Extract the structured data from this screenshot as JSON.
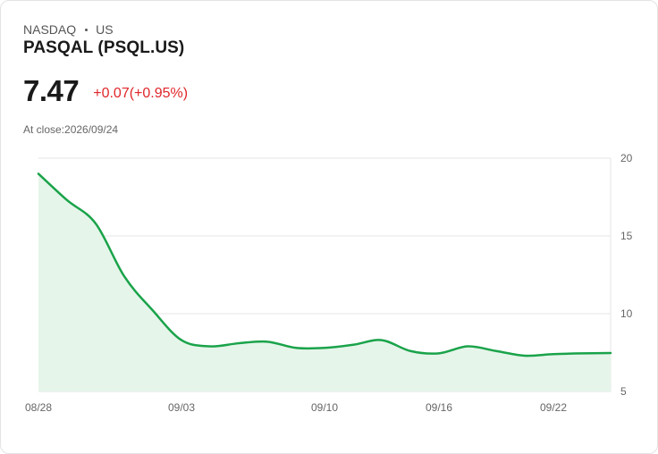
{
  "quote": {
    "exchange": "NASDAQ",
    "market": "US",
    "name": "PASQAL (PSQL.US)",
    "price": "7.47",
    "change": "+0.07(+0.95%)",
    "close_label": "At close:",
    "close_date": "2026/09/24"
  },
  "colors": {
    "up": "#e0262a",
    "line": "#1aa34a",
    "fill": "#e6f5ea",
    "grid": "#e6e6e6"
  },
  "chart_data": {
    "type": "area",
    "title": "",
    "xlabel": "",
    "ylabel": "",
    "ylim": [
      5,
      20
    ],
    "y_ticks": [
      "20",
      "15",
      "10",
      "5"
    ],
    "x_tick_labels": [
      "08/28",
      "09/03",
      "09/10",
      "09/16",
      "09/22"
    ],
    "grid": true,
    "y_axis_side": "right",
    "series": [
      {
        "x": [
          "08/28",
          "08/29",
          "08/30",
          "09/01",
          "09/02",
          "09/03",
          "09/04",
          "09/05",
          "09/08",
          "09/09",
          "09/10",
          "09/11",
          "09/12",
          "09/15",
          "09/16",
          "09/17",
          "09/18",
          "09/19",
          "09/22",
          "09/23",
          "09/24"
        ],
        "values": [
          19.0,
          17.3,
          15.8,
          12.4,
          10.2,
          8.3,
          7.9,
          8.1,
          8.2,
          7.8,
          7.8,
          8.0,
          8.3,
          7.6,
          7.45,
          7.9,
          7.6,
          7.3,
          7.4,
          7.45,
          7.47
        ]
      }
    ]
  }
}
